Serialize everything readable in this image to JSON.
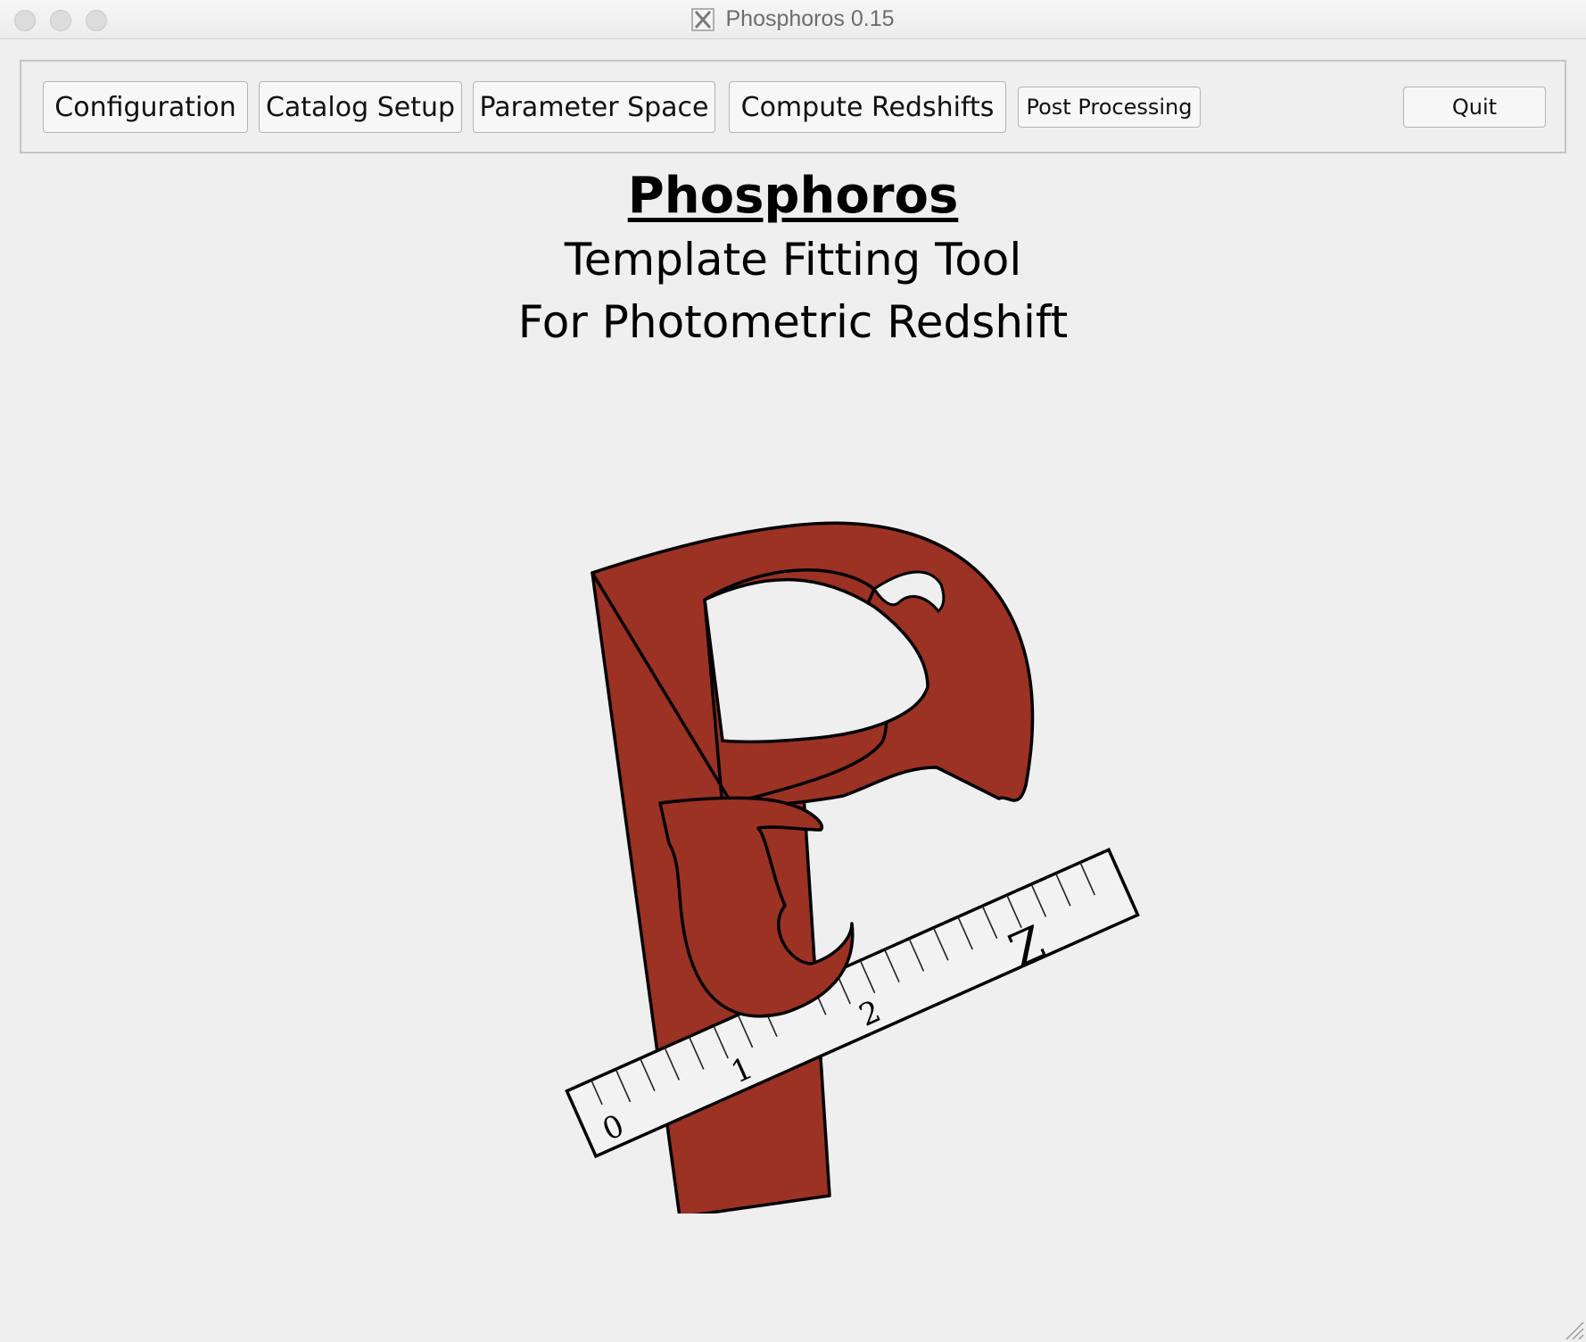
{
  "window": {
    "title": "Phosphoros 0.15",
    "app_icon": "x11-icon"
  },
  "toolbar": {
    "configuration_label": "Configuration",
    "catalog_setup_label": "Catalog Setup",
    "parameter_space_label": "Parameter Space",
    "compute_redshifts_label": "Compute Redshifts",
    "post_processing_label": "Post Processing",
    "quit_label": "Quit"
  },
  "main": {
    "title": "Phosphoros",
    "subtitle_line1": "Template Fitting Tool",
    "subtitle_line2": "For Photometric Redshift"
  },
  "logo": {
    "ruler_labels": [
      "0",
      "1",
      "2",
      "Z"
    ],
    "colors": {
      "letter_fill": "#9b3224",
      "ruler_fill": "#f2f2f2",
      "outline": "#000000"
    }
  }
}
